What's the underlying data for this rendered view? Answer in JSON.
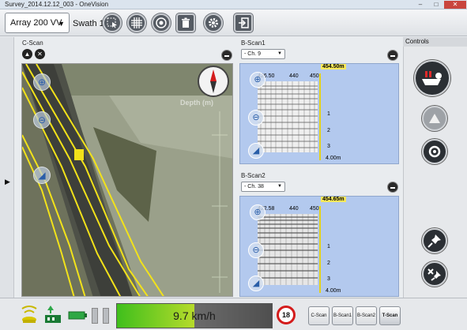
{
  "window": {
    "title": "Survey_2014.12.12_003 - OneVision",
    "minimize": "–",
    "maximize": "□",
    "close": "✕"
  },
  "toolbar": {
    "array_select": "Array 200 VV",
    "swath_label": "Swath 1",
    "icons": [
      "select-icon",
      "grid-icon",
      "target-icon",
      "trash-icon",
      "gear-icon",
      "exit-icon"
    ]
  },
  "cscan": {
    "label": "C-Scan",
    "depth_watermark": "Depth (m)"
  },
  "bscan1": {
    "label": "B-Scan1",
    "channel": "- Ch. 9",
    "distance": "454.50m",
    "ticks_top": [
      "426.50",
      "440",
      "450"
    ],
    "ticks_right": [
      "1",
      "2",
      "3"
    ],
    "depth_bottom": "4.00m"
  },
  "bscan2": {
    "label": "B-Scan2",
    "channel": "- Ch. 38",
    "distance": "454.65m",
    "ticks_top": [
      "422.58",
      "440",
      "450"
    ],
    "ticks_right": [
      "1",
      "2",
      "3"
    ],
    "depth_bottom": "4.00m"
  },
  "controls": {
    "header": "Controls"
  },
  "statusbar": {
    "speed_text": "9.7 km/h",
    "speed_fraction": 0.5,
    "speed_limit": "18",
    "view_buttons": [
      "C-Scan",
      "B-Scan1",
      "B-Scan2",
      "T-Scan"
    ],
    "active_view": "T-Scan"
  },
  "colors": {
    "accent_yellow": "#f2e21a",
    "bscan_bg": "#b3c9ee",
    "speed_green": "#3fbf1c",
    "limit_red": "#d41c1c"
  }
}
